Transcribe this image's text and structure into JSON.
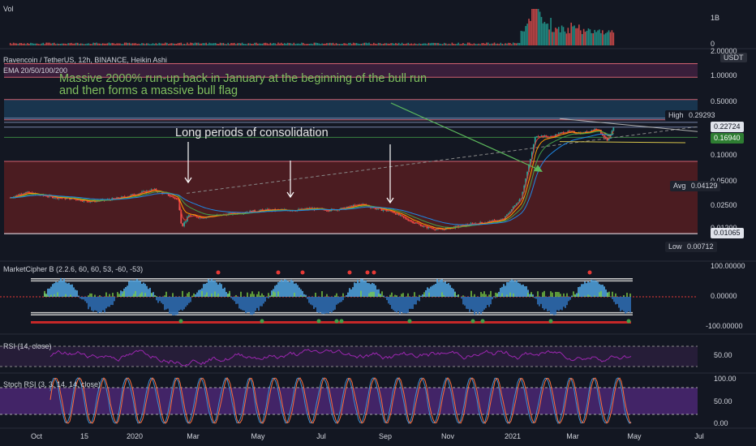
{
  "panes": {
    "volume_label": "Vol",
    "main_title": "Ravencoin / TetherUS, 12h, BINANCE, Heikin Ashi",
    "ema_label": "EMA 20/50/100/200",
    "cipher_label": "MarketCipher B (2.2.6, 60, 60, 53, -60, -53)",
    "rsi_label": "RSI (14, close)",
    "stoch_label": "Stoch RSI (3, 3, 14, 14, close)"
  },
  "annotations": {
    "headline_line1": "Massive 2000% run-up back in January at the beginning of the bull run",
    "headline_line2": "and then forms a massive bull flag",
    "consolidation": "Long periods of consolidation"
  },
  "y_axis": {
    "volume_ticks": [
      "1B",
      "0"
    ],
    "unit": "USDT",
    "price_ticks": [
      "2.00000",
      "1.00000",
      "0.50000",
      "0.10000",
      "0.05000",
      "0.02500",
      "0.01200"
    ],
    "cipher_ticks": [
      "100.00000",
      "0.00000",
      "-100.00000"
    ],
    "rsi_ticks": [
      "50.00"
    ],
    "stoch_ticks": [
      "100.00",
      "50.00",
      "0.00"
    ]
  },
  "price_tags": {
    "high_label": "High",
    "high_value": "0.29293",
    "last_value": "0.22724",
    "level_value": "0.16940",
    "avg_label": "Avg",
    "avg_value": "0.04129",
    "support_value": "0.01065",
    "low_label": "Low",
    "low_value": "0.00712"
  },
  "x_axis": {
    "ticks": [
      "Oct",
      "15",
      "2020",
      "Mar",
      "May",
      "Jul",
      "Sep",
      "Nov",
      "2021",
      "Mar",
      "May",
      "Jul"
    ]
  },
  "colors": {
    "background": "#131722",
    "annotation_green": "#7fbf5e",
    "candle_up": "#26a69a",
    "candle_down": "#ef5350",
    "zone_red": "#7a2020",
    "zone_blue": "#1f4f73",
    "zone_purple": "#5a2750",
    "rsi_line": "#9c27b0",
    "stoch_k": "#3f8fd0",
    "stoch_d": "#ff6d3a"
  },
  "chart_data": {
    "type": "candlestick",
    "symbol": "Ravencoin / TetherUS",
    "interval": "12h",
    "exchange": "BINANCE",
    "scale": "log",
    "ylim": [
      0.007,
      2.0
    ],
    "x_range": [
      "2019-10",
      "2021-07"
    ],
    "close_series": {
      "dates": [
        "2019-10-01",
        "2019-10-15",
        "2019-11-01",
        "2019-11-15",
        "2019-12-01",
        "2019-12-15",
        "2020-01-01",
        "2020-01-15",
        "2020-02-01",
        "2020-02-15",
        "2020-03-01",
        "2020-03-10",
        "2020-03-13",
        "2020-03-20",
        "2020-04-01",
        "2020-04-15",
        "2020-05-01",
        "2020-05-15",
        "2020-06-01",
        "2020-06-15",
        "2020-07-01",
        "2020-07-15",
        "2020-08-01",
        "2020-08-15",
        "2020-09-01",
        "2020-09-15",
        "2020-10-01",
        "2020-10-15",
        "2020-11-01",
        "2020-11-15",
        "2020-12-01",
        "2020-12-15",
        "2021-01-01",
        "2021-01-15",
        "2021-02-01",
        "2021-02-10",
        "2021-02-15",
        "2021-03-01",
        "2021-03-15",
        "2021-04-01",
        "2021-04-15",
        "2021-04-25",
        "2021-05-01"
      ],
      "values": [
        0.03,
        0.035,
        0.032,
        0.03,
        0.029,
        0.027,
        0.028,
        0.03,
        0.034,
        0.038,
        0.032,
        0.028,
        0.013,
        0.018,
        0.017,
        0.018,
        0.019,
        0.02,
        0.021,
        0.021,
        0.021,
        0.022,
        0.021,
        0.022,
        0.025,
        0.022,
        0.02,
        0.016,
        0.013,
        0.012,
        0.013,
        0.014,
        0.015,
        0.016,
        0.03,
        0.09,
        0.18,
        0.17,
        0.2,
        0.19,
        0.22,
        0.15,
        0.227
      ]
    },
    "ema_periods": [
      20,
      50,
      100,
      200
    ],
    "levels": {
      "high": 0.29293,
      "last": 0.22724,
      "level": 0.1694,
      "avg": 0.04129,
      "support": 0.01065,
      "low": 0.00712
    },
    "zones": [
      {
        "from": 0.95,
        "to": 1.4,
        "color": "purple"
      },
      {
        "from": 0.28,
        "to": 0.5,
        "color": "blue"
      },
      {
        "from": 0.0107,
        "to": 0.085,
        "color": "red"
      }
    ],
    "volume_peak_date": "2021-02-15",
    "rsi": {
      "period": 14,
      "bands": [
        70,
        30
      ]
    },
    "stoch_rsi": {
      "params": [
        3,
        3,
        14,
        14
      ],
      "bands": [
        80,
        20
      ]
    },
    "market_cipher": {
      "bands": [
        60,
        53,
        -53,
        -60
      ]
    }
  }
}
